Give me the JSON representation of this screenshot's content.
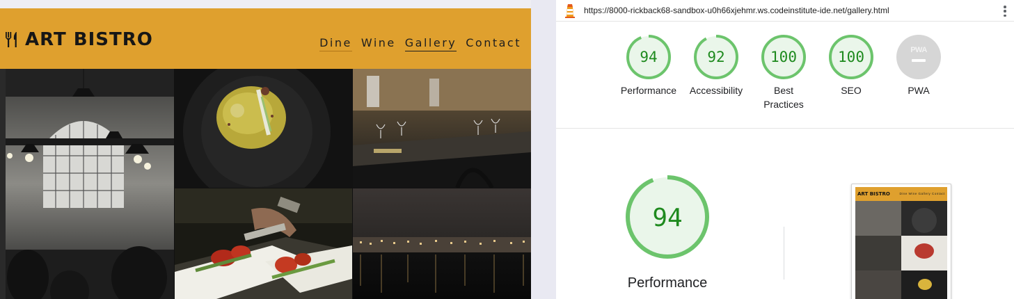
{
  "site": {
    "brand": "ART BISTRO",
    "nav": [
      {
        "label": "Dine",
        "state": "hover"
      },
      {
        "label": "Wine",
        "state": "normal"
      },
      {
        "label": "Gallery",
        "state": "active"
      },
      {
        "label": "Contact",
        "state": "normal"
      }
    ],
    "gallery": [
      {
        "name": "industrial-bistro-interior",
        "alt": "bistro interior with pendant lamps"
      },
      {
        "name": "plated-dish-dark-bowl",
        "alt": "plated dish in dark bowl"
      },
      {
        "name": "restaurant-tables-wine-glasses",
        "alt": "restaurant tables with wine glasses"
      },
      {
        "name": "chef-plating-tomatoes-asparagus",
        "alt": "chef plating tomatoes and asparagus"
      },
      {
        "name": "city-waterfront-night",
        "alt": "city waterfront at night"
      }
    ],
    "colors": {
      "header": "#dfa02e",
      "text": "#161616"
    }
  },
  "lighthouse": {
    "url": "https://8000-rickback68-sandbox-u0h66xjehmr.ws.codeinstitute-ide.net/gallery.html",
    "scores": [
      {
        "label": "Performance",
        "value": "94",
        "fraction": 0.94
      },
      {
        "label": "Accessibility",
        "value": "92",
        "fraction": 0.92
      },
      {
        "label": "Best Practices",
        "value": "100",
        "fraction": 1.0
      },
      {
        "label": "SEO",
        "value": "100",
        "fraction": 1.0
      },
      {
        "label": "PWA",
        "value": "PWA",
        "fraction": 0
      }
    ],
    "main": {
      "label": "Performance",
      "value": "94",
      "fraction": 0.94
    },
    "thumbnail": {
      "brand": "ART BISTRO",
      "nav": "Dine  Wine  Gallery  Contact"
    },
    "colors": {
      "pass": "#0cce6b",
      "pass_stroke": "#6cc46c",
      "pass_bg": "#eaf6ea",
      "pass_text": "#1e8a1e",
      "na": "#d6d6d6"
    }
  }
}
